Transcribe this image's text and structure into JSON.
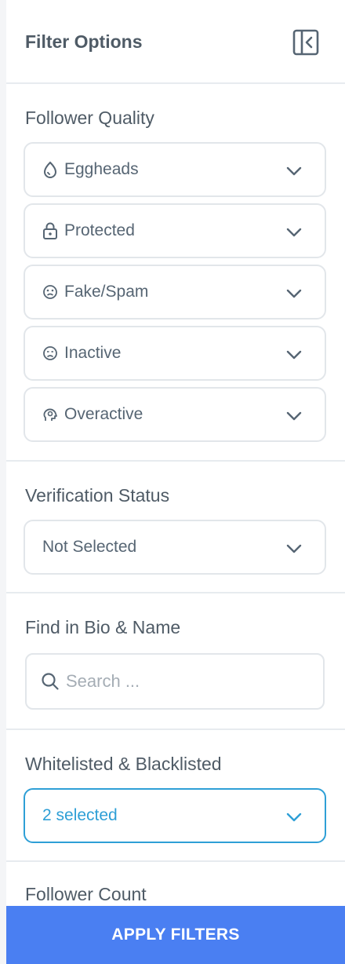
{
  "header": {
    "title": "Filter Options",
    "collapse_icon": "sidebar-collapse-icon"
  },
  "follower_quality": {
    "title": "Follower Quality",
    "items": [
      {
        "label": "Eggheads",
        "icon": "egg-icon"
      },
      {
        "label": "Protected",
        "icon": "lock-icon"
      },
      {
        "label": "Fake/Spam",
        "icon": "sad-face-icon"
      },
      {
        "label": "Inactive",
        "icon": "frown-face-icon"
      },
      {
        "label": "Overactive",
        "icon": "head-gear-icon"
      }
    ]
  },
  "verification": {
    "title": "Verification Status",
    "value": "Not Selected"
  },
  "bio_search": {
    "title": "Find in Bio & Name",
    "placeholder": "Search ..."
  },
  "lists": {
    "title": "Whitelisted & Blacklisted",
    "value": "2 selected"
  },
  "follower_count": {
    "title": "Follower Count"
  },
  "apply": {
    "label": "APPLY FILTERS"
  },
  "colors": {
    "accent": "#2e9fd6",
    "button": "#4a7ff2",
    "text": "#566573"
  }
}
